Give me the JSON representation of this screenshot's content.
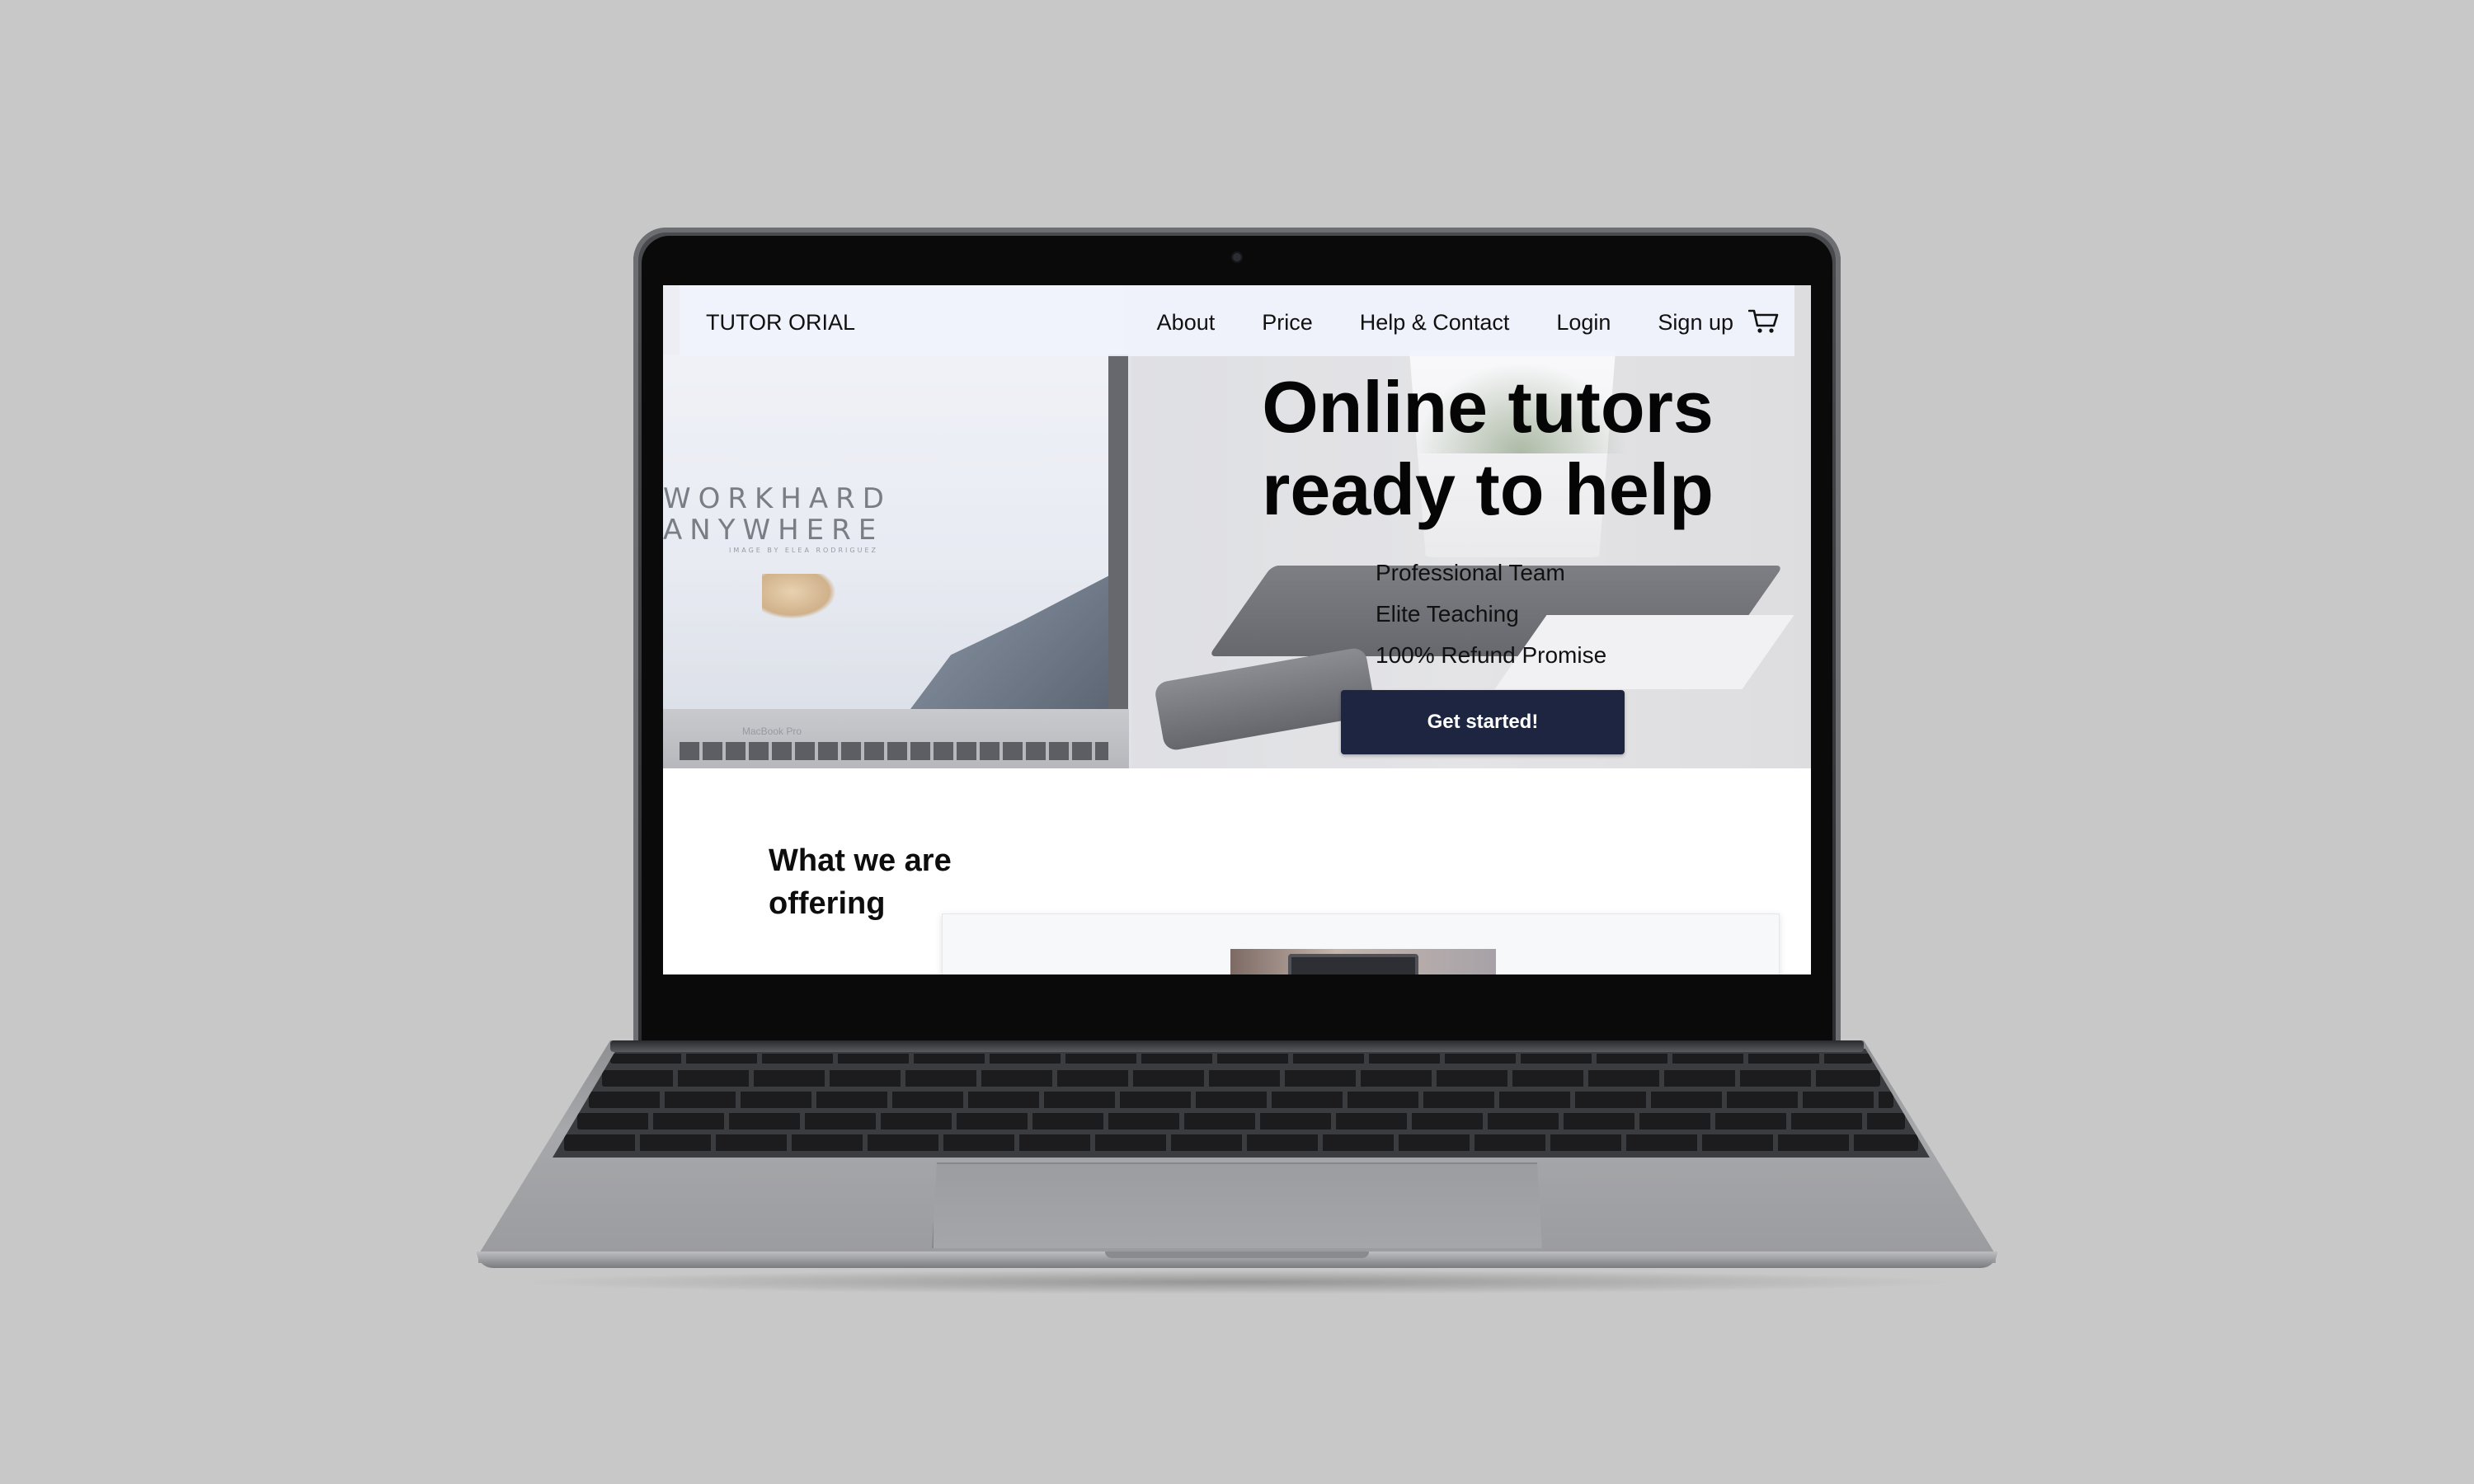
{
  "nav": {
    "brand": "TUTOR ORIAL",
    "links": [
      "About",
      "Price",
      "Help & Contact",
      "Login",
      "Sign up"
    ],
    "cart_icon": "shopping-cart-icon"
  },
  "hero": {
    "title_line1": "Online tutors",
    "title_line2": "ready to help",
    "features": [
      "Professional Team",
      "Elite Teaching",
      "100% Refund Promise"
    ],
    "cta_label": "Get started!",
    "photo_text": {
      "line1": "WORKHARD",
      "line2": "ANYWHERE",
      "small": "IMAGE BY ELEA RODRIGUEZ",
      "caption": "MacBook Pro"
    }
  },
  "offering": {
    "heading_line1": "What we are",
    "heading_line2": "offering"
  },
  "colors": {
    "cta_background": "#1d2541",
    "page_background": "#c8c8c8",
    "nav_background": "#f0f3fc"
  }
}
